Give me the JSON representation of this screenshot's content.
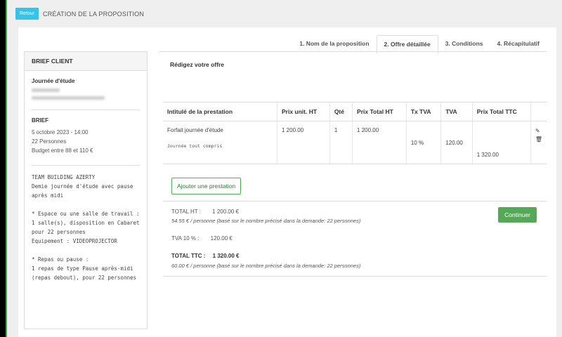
{
  "header": {
    "back_label": "Retour",
    "title": "CRÉATION DE LA PROPOSITION"
  },
  "tabs": [
    {
      "label": "1. Nom de la proposition",
      "active": false
    },
    {
      "label": "2. Offre détaillée",
      "active": true
    },
    {
      "label": "3. Conditions",
      "active": false
    },
    {
      "label": "4. Récapitulatif",
      "active": false
    }
  ],
  "sidebar": {
    "title": "BRIEF CLIENT",
    "event_label": "Journée d'étude",
    "brief_label": "BRIEF",
    "brief_lines": [
      "5 octobre 2023 - 14:00",
      "22 Personnes",
      "Budget entre 88 et 110 €"
    ],
    "notes": "TEAM BUILDING AZERTY\nDemie journée d'étude avec pause après midi\n\n* Espace ou une salle de travail :\n1 salle(s), disposition en Cabaret pour 22 personnes\nEquipement : VIDEOPROJECTOR\n\n* Repas ou pause :\n1 repas de type Pause après-midi (repas debout), pour 22 personnes"
  },
  "main": {
    "subtitle": "Rédigez votre offre",
    "columns": [
      "Intitulé de la prestation",
      "Prix unit. HT",
      "Qté",
      "Prix Total HT",
      "Tx TVA",
      "TVA",
      "Prix Total TTC"
    ],
    "row": {
      "name": "Forfait journée d'étude",
      "note": "Journée tout compris",
      "unit_price": "1 200.00",
      "qty": "1",
      "total_ht": "1 200.00",
      "vat_rate": "10 %",
      "vat": "120.00",
      "total_ttc": "1 320.00"
    },
    "add_label": "Ajouter une prestation",
    "continue_label": "Continuer",
    "totals": {
      "ht_label": "TOTAL HT :",
      "ht_value": "1 200.00 €",
      "ht_per_person": "54.55 € / personne (basé sur le nombre précisé dans la demande: 22 personnes)",
      "vat_label": "TVA 10 % :",
      "vat_value": "120.00 €",
      "ttc_label": "TOTAL TTC :",
      "ttc_value": "1 320.00 €",
      "ttc_per_person": "60.00 € / personne (basé sur le nombre précisé dans la demande: 22 personnes)"
    }
  }
}
